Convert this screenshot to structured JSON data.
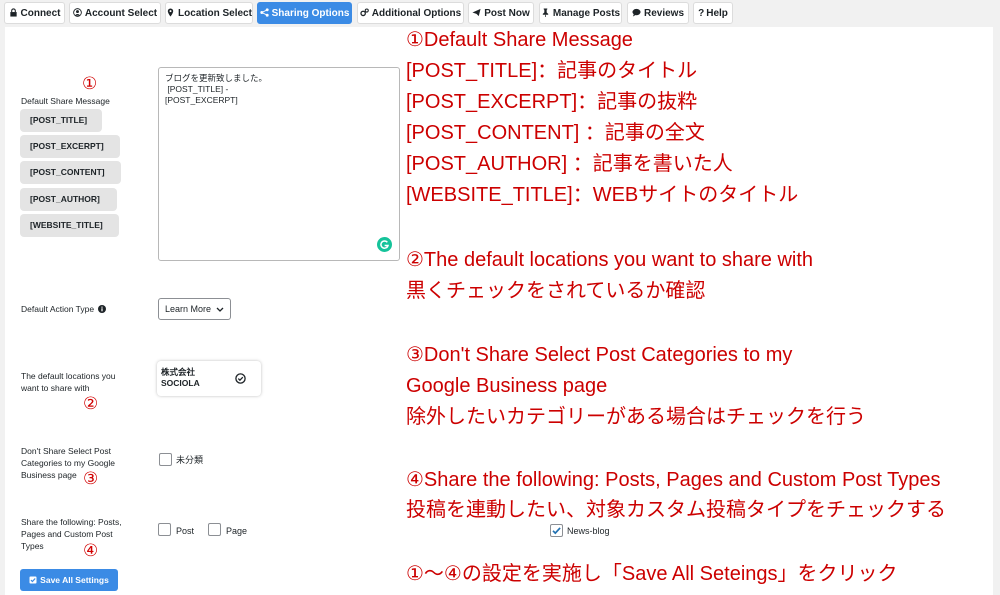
{
  "tabs": [
    {
      "label": "Connect",
      "icon": "lock-icon",
      "active": false
    },
    {
      "label": "Account Select",
      "icon": "user-circle-icon",
      "active": false
    },
    {
      "label": "Location Select",
      "icon": "map-marker-icon",
      "active": false
    },
    {
      "label": "Sharing Options",
      "icon": "share-icon",
      "active": true
    },
    {
      "label": "Additional Options",
      "icon": "cogs-icon",
      "active": false
    },
    {
      "label": "Post Now",
      "icon": "paper-plane-icon",
      "active": false
    },
    {
      "label": "Manage Posts",
      "icon": "thumbtack-icon",
      "active": false
    },
    {
      "label": "Reviews",
      "icon": "comment-icon",
      "active": false
    },
    {
      "label": "Help",
      "icon": "question-icon",
      "active": false
    }
  ],
  "form": {
    "default_share_message": {
      "label": "Default Share Message",
      "tags": [
        "[POST_TITLE]",
        "[POST_EXCERPT]",
        "[POST_CONTENT]",
        "[POST_AUTHOR]",
        "[WEBSITE_TITLE]"
      ],
      "value_lines": [
        "ブログを更新致しました。",
        " [POST_TITLE] -",
        "[POST_EXCERPT]"
      ]
    },
    "default_action_type": {
      "label": "Default Action Type",
      "selected": "Learn More"
    },
    "default_locations": {
      "label_line1": "The default locations you",
      "label_line2": "want to share with",
      "location_name_line1": "株式会社",
      "location_name_line2": "SOCIOLA",
      "checked": true
    },
    "dont_share_categories": {
      "label_line1": "Don't Share Select Post",
      "label_line2": "Categories to my Google",
      "label_line3": "Business page",
      "options": [
        {
          "label": "未分類",
          "checked": false
        }
      ]
    },
    "share_following": {
      "label_line1": "Share the following: Posts,",
      "label_line2": "Pages and Custom Post",
      "label_line3": "Types",
      "options": [
        {
          "label": "Post",
          "checked": false
        },
        {
          "label": "Page",
          "checked": false
        },
        {
          "label": "News-blog",
          "checked": true
        }
      ]
    },
    "save_button": "Save All Settings"
  },
  "markers": [
    "①",
    "②",
    "③",
    "④"
  ],
  "notes": [
    "①Default Share Message",
    "[POST_TITLE]：記事のタイトル",
    "[POST_EXCERPT]：記事の抜粋",
    "[POST_CONTENT] ：記事の全文",
    "[POST_AUTHOR] ：記事を書いた人",
    "[WEBSITE_TITLE]：WEBサイトのタイトル",
    "②The default locations you want to share with",
    "黒くチェックをされているか確認",
    "③Don't Share Select Post Categories to my",
    "Google Business page",
    "除外したいカテゴリーがある場合はチェックを行う",
    "④Share the following: Posts, Pages and Custom Post Types",
    "投稿を連動したい、対象カスタム投稿タイプをチェックする",
    "①～④の設定を実施し「Save All Seteings」をクリック"
  ],
  "colors": {
    "accent": "#3b8be5",
    "annotation": "#cc0000",
    "grammarly": "#15c39a"
  }
}
